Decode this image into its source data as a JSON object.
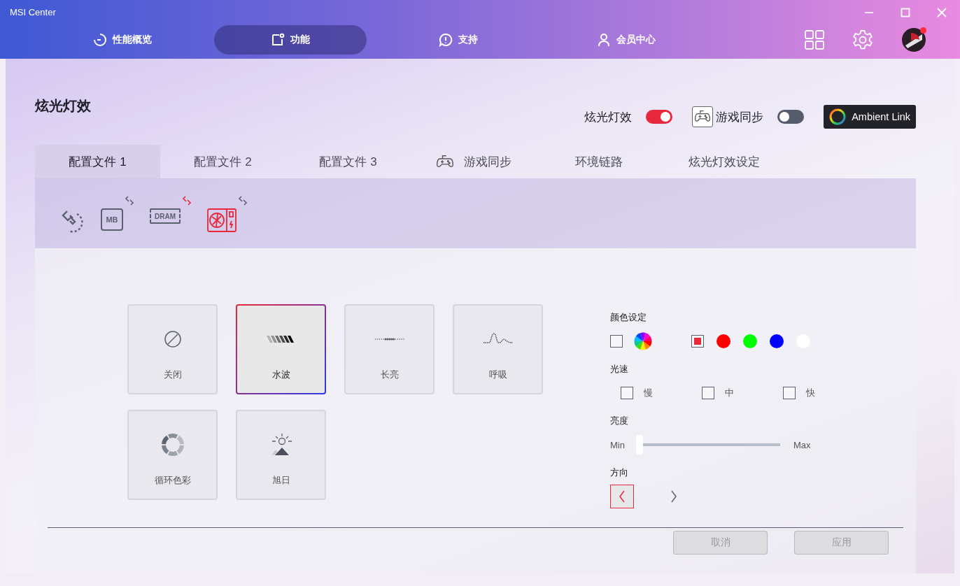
{
  "window": {
    "title": "MSI Center"
  },
  "nav_tabs": [
    {
      "label": "性能概览",
      "kind": "gauge",
      "selected": false
    },
    {
      "label": "功能",
      "kind": "feature",
      "selected": true
    },
    {
      "label": "支持",
      "kind": "support",
      "selected": false
    },
    {
      "label": "会员中心",
      "kind": "member",
      "selected": false
    }
  ],
  "page": {
    "title": "炫光灯效"
  },
  "toggles": [
    {
      "label": "炫光灯效",
      "kind": "plain",
      "on": true
    },
    {
      "label": "游戏同步",
      "kind": "gamepad",
      "on": false
    }
  ],
  "ambient_link_button": "Ambient Link",
  "profile_tabs": [
    {
      "label": "配置文件 1",
      "kind": "text",
      "selected": true
    },
    {
      "label": "配置文件 2",
      "kind": "text",
      "selected": false
    },
    {
      "label": "配置文件 3",
      "kind": "text",
      "selected": false
    },
    {
      "label": "游戏同步",
      "kind": "gamepad",
      "selected": false
    },
    {
      "label": "环境链路",
      "kind": "text",
      "selected": false
    },
    {
      "label": "炫光灯效设定",
      "kind": "text",
      "selected": false
    }
  ],
  "devices": [
    {
      "kind": "sync",
      "selected": false
    },
    {
      "kind": "mb",
      "label": "MB",
      "selected": false,
      "linked": false
    },
    {
      "kind": "dram",
      "label": "DRAM",
      "selected": false,
      "linked": true
    },
    {
      "kind": "gpu",
      "selected": true,
      "linked": false
    }
  ],
  "effects": [
    {
      "label": "关闭",
      "kind": "off",
      "selected": false
    },
    {
      "label": "水波",
      "kind": "wave",
      "selected": true
    },
    {
      "label": "长亮",
      "kind": "steady",
      "selected": false
    },
    {
      "label": "呼吸",
      "kind": "breathing",
      "selected": false
    },
    {
      "label": "循环色彩",
      "kind": "cycle",
      "selected": false
    },
    {
      "label": "旭日",
      "kind": "sunrise",
      "selected": false
    }
  ],
  "color_settings": {
    "label": "颜色设定",
    "modes": [
      {
        "kind": "rainbow",
        "checked": false
      },
      {
        "kind": "custom",
        "checked": true,
        "swatches": [
          {
            "color": "#ff0000"
          },
          {
            "color": "#00ff00"
          },
          {
            "color": "#0000ff"
          },
          {
            "color": "#ffffff"
          }
        ]
      }
    ]
  },
  "speed": {
    "label": "光速",
    "options": [
      {
        "label": "慢",
        "checked": false
      },
      {
        "label": "中",
        "checked": false
      },
      {
        "label": "快",
        "checked": false
      }
    ]
  },
  "brightness": {
    "label": "亮度",
    "min_label": "Min",
    "max_label": "Max",
    "level": 0
  },
  "direction": {
    "label": "方向",
    "options": [
      {
        "kind": "left",
        "selected": true
      },
      {
        "kind": "right",
        "selected": false
      }
    ]
  },
  "buttons": [
    {
      "label": "取消",
      "disabled": true
    },
    {
      "label": "应用",
      "disabled": true
    }
  ]
}
